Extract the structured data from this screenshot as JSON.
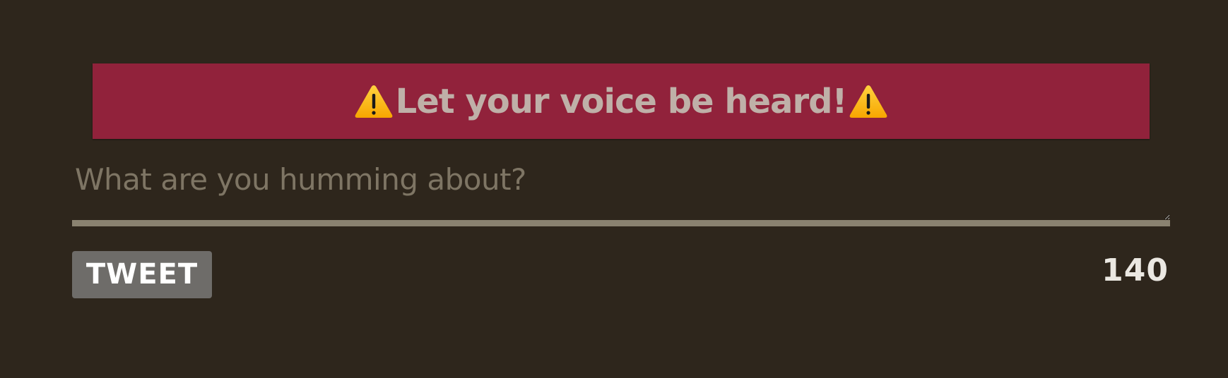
{
  "banner": {
    "text": "Let your voice be heard!",
    "icon_left": "warning-icon",
    "icon_right": "warning-icon",
    "background": "#91223b"
  },
  "composer": {
    "placeholder": "What are you humming about?",
    "value": ""
  },
  "actions": {
    "tweet_label": "TWEET",
    "char_remaining": "140"
  },
  "colors": {
    "page_bg": "#2e261c",
    "button_bg": "#6e6c69",
    "underline": "#8a8270",
    "banner_text": "#bfb0a8"
  }
}
